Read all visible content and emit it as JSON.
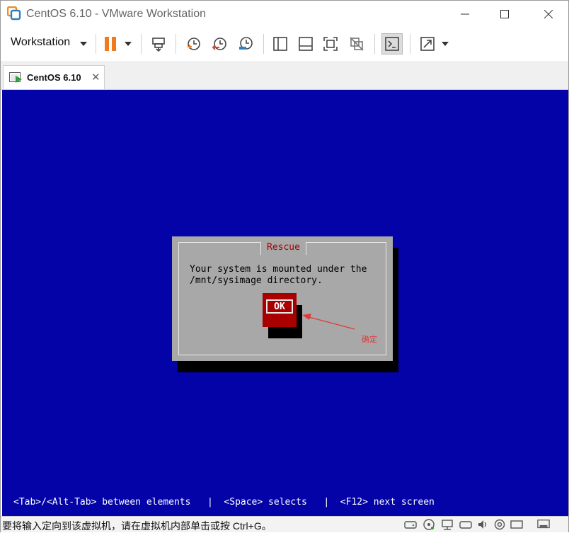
{
  "window": {
    "title": "CentOS 6.10 - VMware Workstation"
  },
  "toolbar": {
    "menu_label": "Workstation"
  },
  "tabs": [
    {
      "label": "CentOS 6.10"
    }
  ],
  "console": {
    "dialog_title": "Rescue",
    "dialog_message_line1": "Your system is mounted under the",
    "dialog_message_line2": "/mnt/sysimage directory.",
    "ok_label": "OK",
    "annotation_label": "确定",
    "hint_tab": "<Tab>/<Alt-Tab> between elements",
    "hint_sep1": "|",
    "hint_space": "<Space> selects",
    "hint_sep2": "|",
    "hint_f12": "<F12> next screen"
  },
  "statusbar": {
    "message": "要将输入定向到该虚拟机，请在虚拟机内部单击或按 Ctrl+G。"
  },
  "colors": {
    "console_bg": "#0303a8",
    "dialog_bg": "#a8a8a8",
    "dialog_title": "#a80000",
    "ok_button": "#a80000",
    "pause_orange": "#f07a1e",
    "annotation_red": "#e23a3a"
  },
  "icons": [
    "vmware-app-icon",
    "minimize-icon",
    "maximize-icon",
    "close-icon",
    "pause-icon",
    "send-ctrl-alt-del-icon",
    "snapshot-take-icon",
    "snapshot-revert-icon",
    "snapshot-manager-icon",
    "library-icon",
    "thumbnail-bar-icon",
    "fullscreen-icon",
    "unity-icon",
    "console-view-icon",
    "stretch-icon",
    "vm-running-icon",
    "tab-close-icon",
    "hdd-icon",
    "cdrom-icon",
    "network-icon",
    "usb-icon",
    "sound-icon",
    "printer-icon",
    "display-icon"
  ]
}
